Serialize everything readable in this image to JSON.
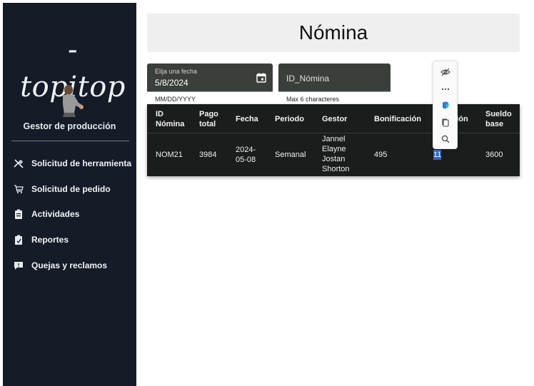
{
  "brand": {
    "logo_text": "-topitop",
    "role": "Gestor de producción"
  },
  "nav": [
    {
      "label": "Solicitud de herramienta",
      "icon": "tools-icon"
    },
    {
      "label": "Solicitud de pedido",
      "icon": "cart-icon"
    },
    {
      "label": "Actividades",
      "icon": "clipboard-icon"
    },
    {
      "label": "Reportes",
      "icon": "report-icon"
    },
    {
      "label": "Quejas y reclamos",
      "icon": "feedback-icon"
    }
  ],
  "header": {
    "title": "Nómina"
  },
  "filters": {
    "date": {
      "label": "Elija una fecha",
      "value": "5/8/2024",
      "hint": "MM/DD/YYYY"
    },
    "id": {
      "placeholder": "ID_Nómina",
      "hint": "Max 6 characteres"
    }
  },
  "table": {
    "headers": [
      [
        "ID",
        "Nómina"
      ],
      [
        "Pago",
        "total"
      ],
      [
        "Fecha"
      ],
      [
        "Periodo"
      ],
      [
        "Gestor"
      ],
      [
        "Bonificación"
      ],
      [
        "",
        "ación"
      ],
      [
        "Sueldo",
        "base"
      ]
    ],
    "row": {
      "id": "NOM21",
      "pago_total": "3984",
      "fecha": [
        "2024-",
        "05-08"
      ],
      "periodo": "Semanal",
      "gestor": [
        "Jannel",
        "Elayne",
        "Jostan",
        "Shorton"
      ],
      "bonificacion": "495",
      "col7": "11",
      "sueldo_base": "3600"
    }
  },
  "colors": {
    "sidebar": "#151b27",
    "field": "#3b3f3b",
    "table": "#1b1c1c",
    "header": "#efefef",
    "selection": "#2f66c7"
  },
  "context_toolbar": [
    "hide-icon",
    "more-icon",
    "copilot-icon",
    "copy-icon",
    "search-icon"
  ]
}
